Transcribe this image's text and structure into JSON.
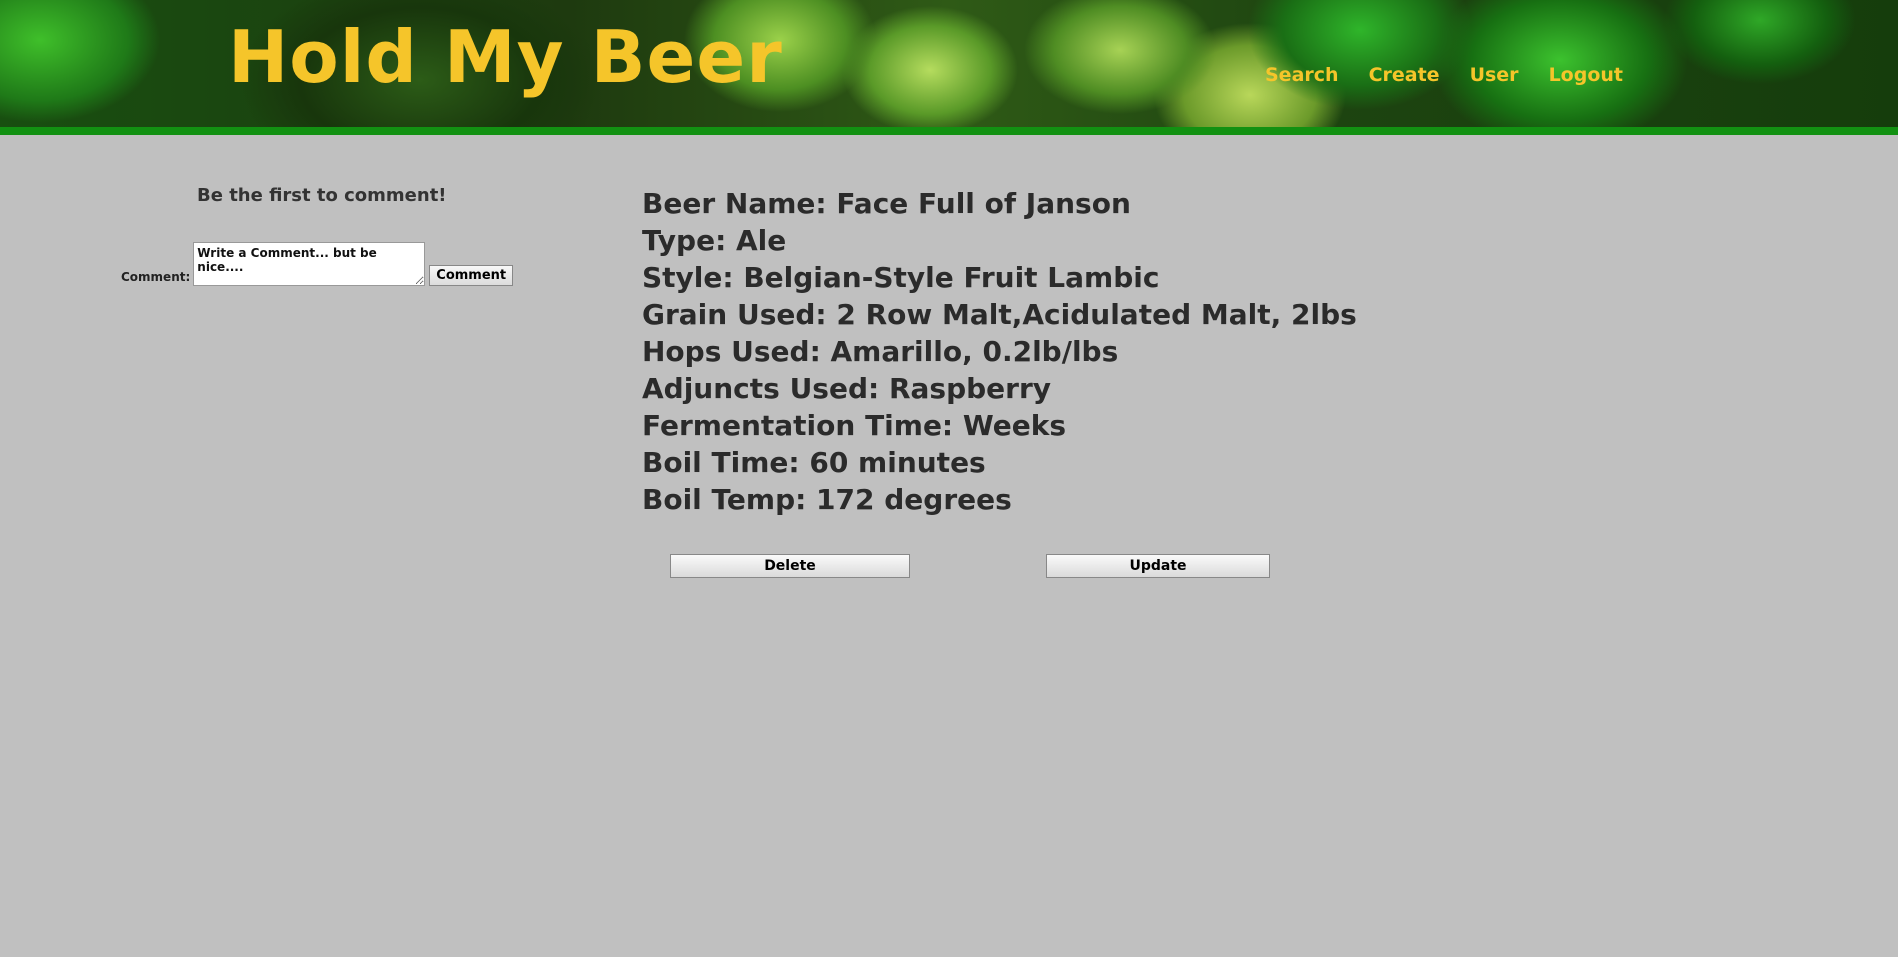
{
  "header": {
    "title": "Hold My Beer",
    "nav": [
      "Search",
      "Create",
      "User",
      "Logout"
    ]
  },
  "comments": {
    "heading": "Be the first to comment!",
    "label": "Comment:",
    "placeholder": "Write a Comment... but be nice....",
    "button_label": "Comment"
  },
  "beer": {
    "details": [
      "Beer Name: Face Full of Janson",
      "Type: Ale",
      "Style: Belgian-Style Fruit Lambic",
      "Grain Used: 2 Row Malt,Acidulated Malt, 2lbs",
      "Hops Used: Amarillo, 0.2lb/lbs",
      "Adjuncts Used: Raspberry",
      "Fermentation Time: Weeks",
      "Boil Time: 60 minutes",
      "Boil Temp: 172 degrees"
    ]
  },
  "actions": {
    "delete_label": "Delete",
    "update_label": "Update"
  },
  "colors": {
    "background": "#c0c0c0",
    "accent_yellow": "#f5c52a",
    "header_bar_green": "#129112",
    "text_dark": "#2b2b2b"
  }
}
